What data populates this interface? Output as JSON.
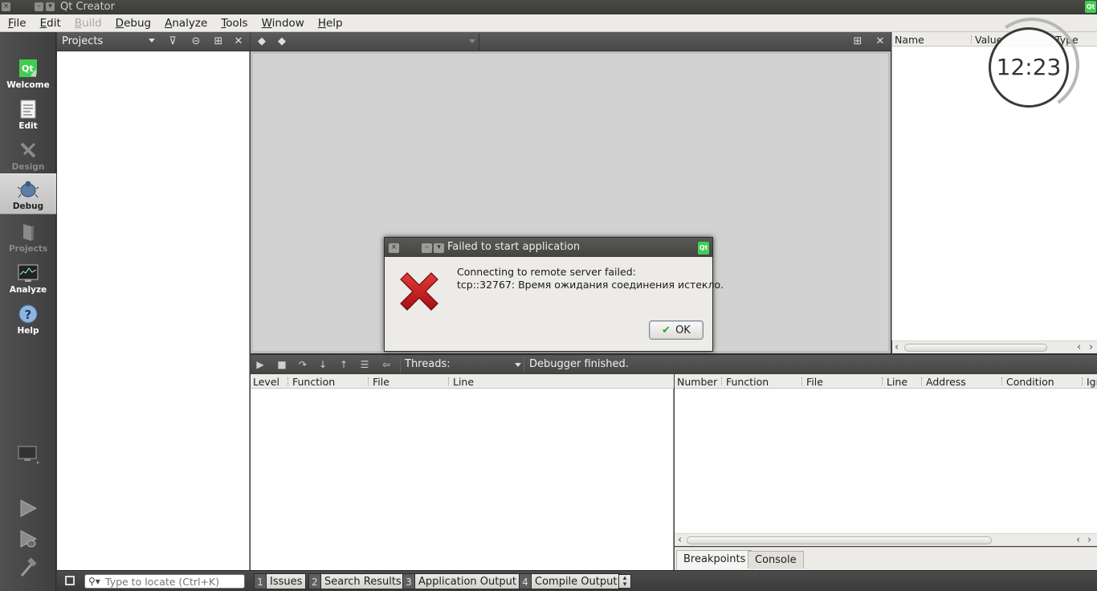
{
  "window": {
    "title": "Qt Creator"
  },
  "menu": [
    "File",
    "Edit",
    "Build",
    "Debug",
    "Analyze",
    "Tools",
    "Window",
    "Help"
  ],
  "menu_disabled": [
    "Build"
  ],
  "modes": [
    {
      "label": "Welcome",
      "icon": "qt-logo-icon",
      "state": "normal"
    },
    {
      "label": "Edit",
      "icon": "document-icon",
      "state": "normal"
    },
    {
      "label": "Design",
      "icon": "design-pen-icon",
      "state": "disabled"
    },
    {
      "label": "Debug",
      "icon": "bug-icon",
      "state": "active"
    },
    {
      "label": "Projects",
      "icon": "folder-icon",
      "state": "disabled"
    },
    {
      "label": "Analyze",
      "icon": "analyze-monitor-icon",
      "state": "normal"
    },
    {
      "label": "Help",
      "icon": "help-question-icon",
      "state": "normal"
    }
  ],
  "projects_pane": {
    "title": "Projects"
  },
  "locals_pane": {
    "columns": [
      "Name",
      "Value",
      "Type"
    ]
  },
  "clock": {
    "time": "12:23"
  },
  "debug_toolbar": {
    "threads_label": "Threads:",
    "status": "Debugger finished."
  },
  "stack_pane": {
    "columns": [
      "Level",
      "Function",
      "File",
      "Line"
    ]
  },
  "breakpoints_pane": {
    "columns": [
      "Number",
      "Function",
      "File",
      "Line",
      "Address",
      "Condition",
      "Igr"
    ],
    "tabs": [
      "Breakpoints",
      "Console"
    ],
    "active_tab": "Breakpoints"
  },
  "bottom_bar": {
    "locator_placeholder": "Type to locate (Ctrl+K)",
    "output_tabs": [
      {
        "num": "1",
        "label": "Issues"
      },
      {
        "num": "2",
        "label": "Search Results"
      },
      {
        "num": "3",
        "label": "Application Output"
      },
      {
        "num": "4",
        "label": "Compile Output"
      }
    ]
  },
  "dialog": {
    "title": "Failed to start application",
    "message_line1": "Connecting to remote server failed:",
    "message_line2": "tcp::32767: Время ожидания соединения истекло.",
    "ok_label": "OK",
    "icon": "error-x-icon"
  },
  "colors": {
    "error_red": "#c8171b",
    "qt_green": "#41cd52",
    "ok_check": "#2fa52b"
  }
}
